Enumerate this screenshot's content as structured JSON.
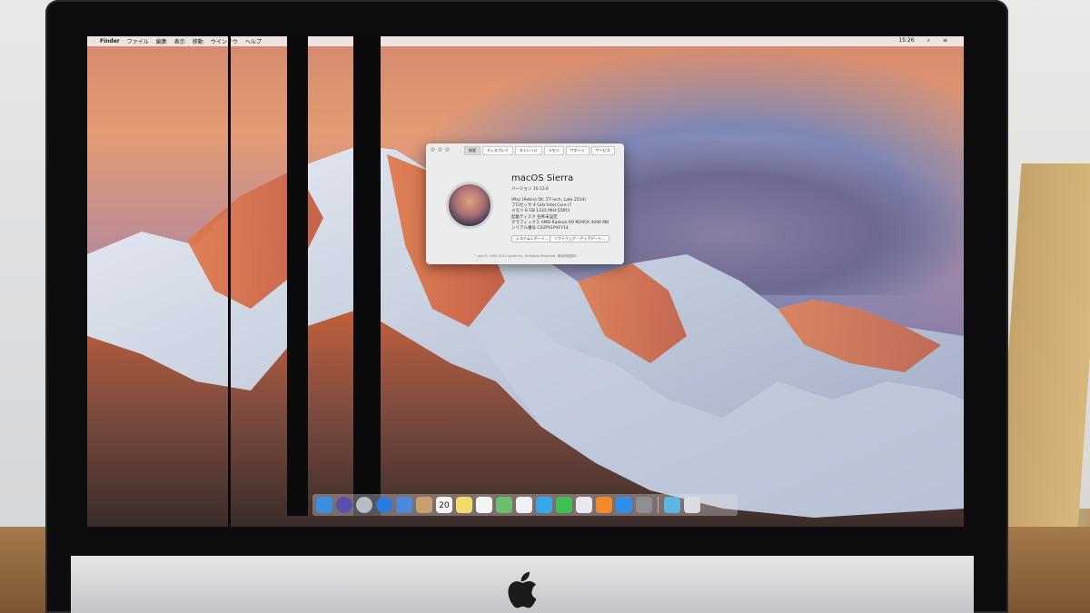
{
  "menubar": {
    "apple": "",
    "items": [
      "Finder",
      "ファイル",
      "編集",
      "表示",
      "移動",
      "ウインドウ",
      "ヘルプ"
    ],
    "time": "15:26"
  },
  "about_window": {
    "tabs": [
      "概要",
      "ディスプレイ",
      "ストレージ",
      "メモリ",
      "サポート",
      "サービス"
    ],
    "os_name": "macOS Sierra",
    "version": "バージョン 10.12.6",
    "specs": [
      "iMac (Retina 5K, 27-inch, Late 2014)",
      "プロセッサ 4 GHz Intel Core i7",
      "メモリ 8 GB 1333 MHz DDR3",
      "起動ディスク 名称未設定",
      "グラフィックス AMD Radeon R9 M295X 4096 MB",
      "シリアル番号 C02PX1PXFY14"
    ],
    "buttons": {
      "system_report": "システムレポート...",
      "software_update": "ソフトウェア・アップデート..."
    },
    "footer": "™ and © 1983–2017 Apple Inc. All Rights Reserved. 使用許諾契約"
  },
  "dock": {
    "icons": [
      {
        "name": "finder-icon",
        "color": "#3b8fe0"
      },
      {
        "name": "siri-icon",
        "color": "#5a4fb0"
      },
      {
        "name": "launchpad-icon",
        "color": "#b8bcc4"
      },
      {
        "name": "safari-icon",
        "color": "#2a7be0"
      },
      {
        "name": "mail-icon",
        "color": "#4a8ad8"
      },
      {
        "name": "contacts-icon",
        "color": "#c8a070"
      },
      {
        "name": "calendar-icon",
        "color": "#f4f4f4"
      },
      {
        "name": "notes-icon",
        "color": "#f2dd6a"
      },
      {
        "name": "reminders-icon",
        "color": "#f4f4f4"
      },
      {
        "name": "maps-icon",
        "color": "#6bbf6a"
      },
      {
        "name": "photos-icon",
        "color": "#f1f1f1"
      },
      {
        "name": "messages-icon",
        "color": "#35a8e8"
      },
      {
        "name": "facetime-icon",
        "color": "#3fbf54"
      },
      {
        "name": "itunes-icon",
        "color": "#e8e8ee"
      },
      {
        "name": "ibooks-icon",
        "color": "#f08a2a"
      },
      {
        "name": "app-store-icon",
        "color": "#2f8ee8"
      },
      {
        "name": "system-preferences-icon",
        "color": "#8e8e93"
      },
      {
        "name": "downloads-folder-icon",
        "color": "#5fb4e6"
      },
      {
        "name": "trash-icon",
        "color": "#d9dce0"
      }
    ],
    "calendar_day": "20"
  }
}
